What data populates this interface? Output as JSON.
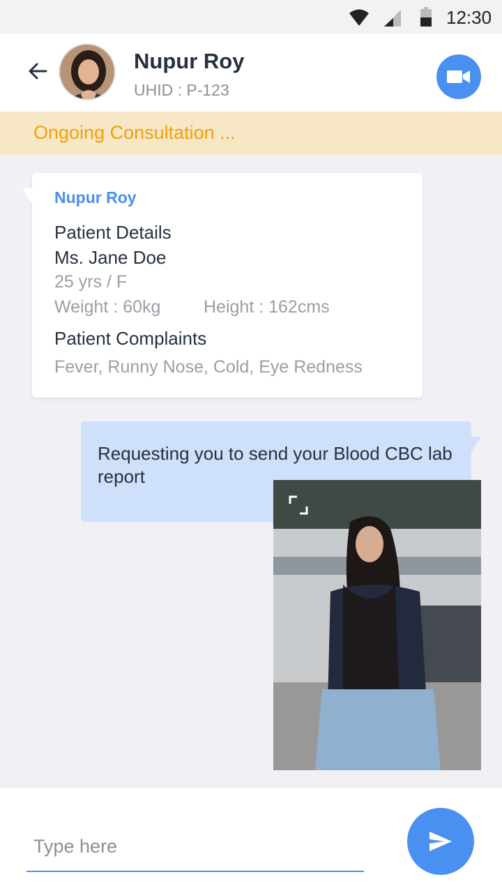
{
  "status_bar": {
    "time": "12:30"
  },
  "header": {
    "name": "Nupur Roy",
    "uhid": "UHID : P-123"
  },
  "banner": {
    "text": "Ongoing Consultation ..."
  },
  "patient_card": {
    "sender": "Nupur Roy",
    "section_title": "Patient Details",
    "patient_name": "Ms. Jane Doe",
    "age_gender": "25 yrs / F",
    "weight": "Weight : 60kg",
    "height": "Height : 162cms",
    "complaints_title": "Patient Complaints",
    "complaints": "Fever, Runny Nose, Cold, Eye Redness"
  },
  "outgoing_message": {
    "text": "Requesting you to send your Blood CBC lab report"
  },
  "composer": {
    "placeholder": "Type here"
  },
  "icons": {
    "back": "arrow-left-icon",
    "video": "video-camera-icon",
    "expand": "expand-icon",
    "send": "send-icon",
    "wifi": "wifi-icon",
    "signal": "cell-signal-icon",
    "battery": "battery-icon"
  },
  "colors": {
    "accent": "#4a90f0",
    "banner_bg": "#f7e7c6",
    "banner_text": "#f0a10a",
    "bubble_bg": "#cfe0fb"
  }
}
